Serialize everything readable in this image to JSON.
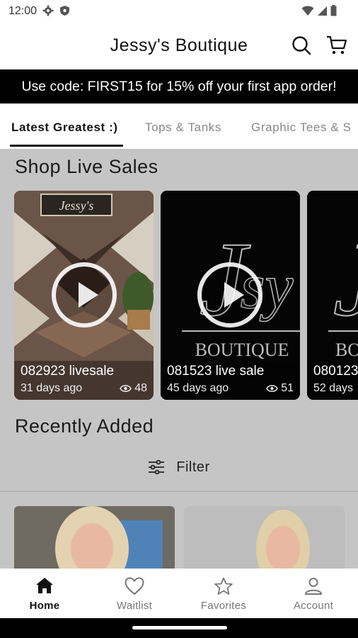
{
  "status_bar": {
    "time": "12:00"
  },
  "header": {
    "title": "Jessy's Boutique"
  },
  "promo": {
    "text": "Use code: FIRST15 for 15% off your first app order!"
  },
  "tabs": [
    {
      "label": "Latest Greatest :)",
      "active": true
    },
    {
      "label": "Tops & Tanks",
      "active": false
    },
    {
      "label": "Graphic Tees & S",
      "active": false
    }
  ],
  "live_sales": {
    "title": "Shop Live Sales",
    "items": [
      {
        "name": "082923 livesale",
        "age": "31 days ago",
        "views": "48"
      },
      {
        "name": "081523 live sale",
        "age": "45 days ago",
        "views": "51"
      },
      {
        "name": "080123",
        "age": "52 days",
        "views": ""
      }
    ],
    "logo_text": "BOUTIQUE"
  },
  "recently_added": {
    "title": "Recently Added",
    "filter_label": "Filter"
  },
  "bottom_nav": [
    {
      "label": "Home",
      "icon": "home-icon",
      "active": true
    },
    {
      "label": "Waitlist",
      "icon": "heart-icon",
      "active": false
    },
    {
      "label": "Favorites",
      "icon": "star-icon",
      "active": false
    },
    {
      "label": "Account",
      "icon": "person-icon",
      "active": false
    }
  ],
  "colors": {
    "promo_bg": "#000000",
    "overlay": "#c5c5c5",
    "accent": "#111111"
  }
}
